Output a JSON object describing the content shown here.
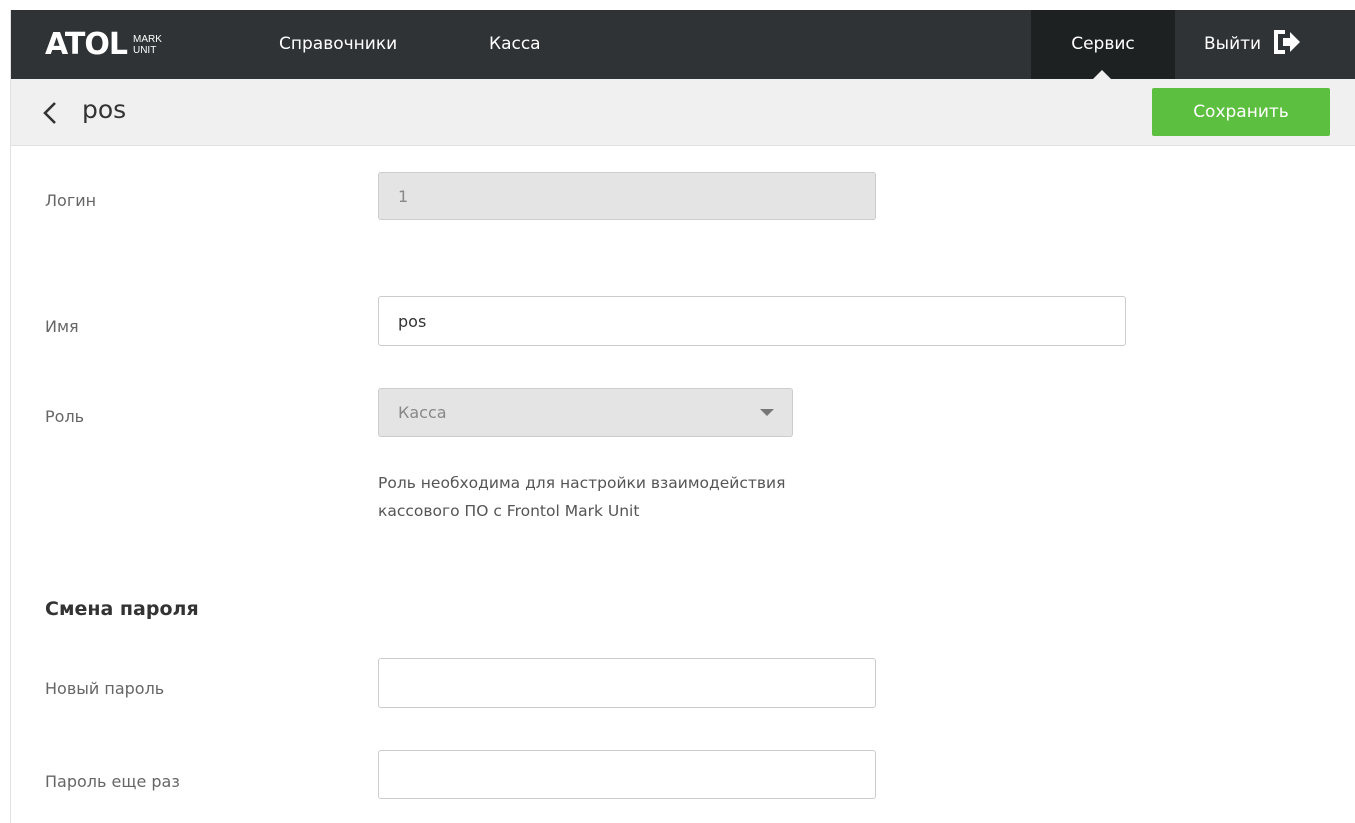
{
  "header": {
    "logo_main": "ATOL",
    "logo_sub_top": "MARK",
    "logo_sub_bottom": "UNIT",
    "nav": {
      "references": "Справочники",
      "kassa": "Касса",
      "service": "Сервис",
      "logout": "Выйти"
    }
  },
  "subheader": {
    "title": "pos",
    "save_label": "Сохранить"
  },
  "form": {
    "login": {
      "label": "Логин",
      "value": "1"
    },
    "name": {
      "label": "Имя",
      "value": "pos"
    },
    "role": {
      "label": "Роль",
      "value": "Касса",
      "hint_line1": "Роль необходима для настройки взаимодействия",
      "hint_line2": "кассового ПО с Frontol Mark Unit"
    },
    "password_section": {
      "title": "Смена пароля",
      "new_password": {
        "label": "Новый пароль",
        "value": ""
      },
      "repeat_password": {
        "label": "Пароль еще раз",
        "value": ""
      }
    }
  },
  "colors": {
    "topbar": "#2f3335",
    "active_nav": "#1e2122",
    "save_button": "#5cbf3f",
    "subbar": "#f0f0f0"
  },
  "icons": {
    "back": "chevron-left-icon",
    "logout": "logout-icon",
    "dropdown": "caret-down-icon"
  }
}
